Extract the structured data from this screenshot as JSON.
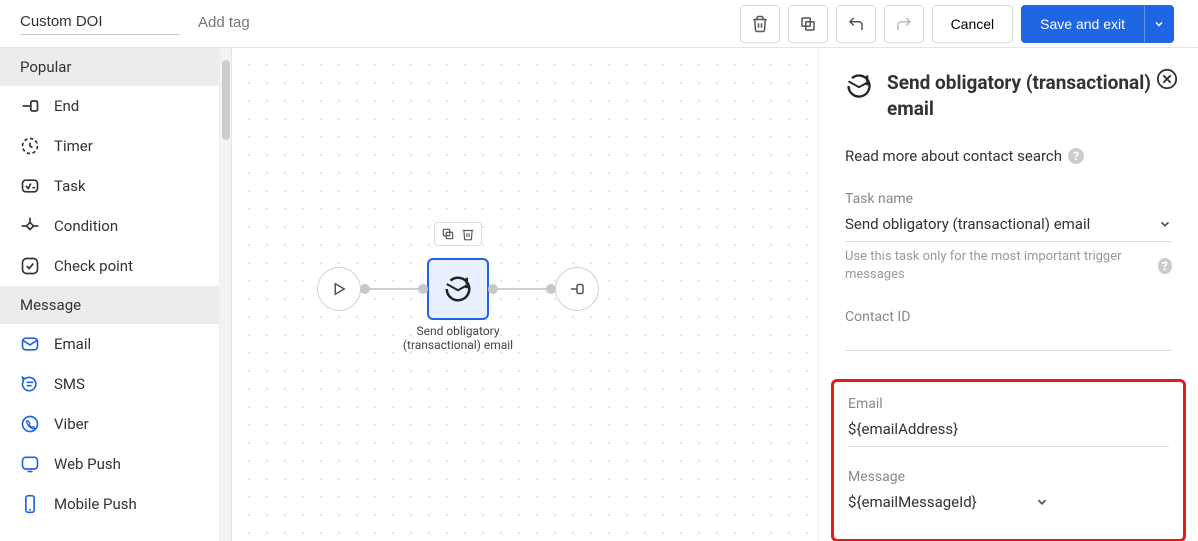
{
  "header": {
    "title": "Custom DOI",
    "add_tag_placeholder": "Add tag",
    "cancel": "Cancel",
    "save": "Save and exit"
  },
  "sidebar": {
    "groups": [
      {
        "label": "Popular",
        "items": [
          {
            "icon": "end-icon",
            "label": "End"
          },
          {
            "icon": "timer-icon",
            "label": "Timer"
          },
          {
            "icon": "task-icon",
            "label": "Task"
          },
          {
            "icon": "condition-icon",
            "label": "Condition"
          },
          {
            "icon": "checkpoint-icon",
            "label": "Check point"
          }
        ]
      },
      {
        "label": "Message",
        "items": [
          {
            "icon": "email-icon",
            "label": "Email"
          },
          {
            "icon": "sms-icon",
            "label": "SMS"
          },
          {
            "icon": "viber-icon",
            "label": "Viber"
          },
          {
            "icon": "webpush-icon",
            "label": "Web Push"
          },
          {
            "icon": "mobilepush-icon",
            "label": "Mobile Push"
          }
        ]
      }
    ]
  },
  "canvas": {
    "middle_node_label": "Send obligatory (transactional) email"
  },
  "panel": {
    "title": "Send obligatory (transactional) email",
    "read_more": "Read more about contact search",
    "task_name_label": "Task name",
    "task_name_value": "Send obligatory (transactional) email",
    "task_name_help": "Use this task only for the most important trigger messages",
    "contact_id_label": "Contact ID",
    "contact_id_value": "",
    "email_label": "Email",
    "email_value": "${emailAddress}",
    "message_label": "Message",
    "message_value": "${emailMessageId}"
  }
}
